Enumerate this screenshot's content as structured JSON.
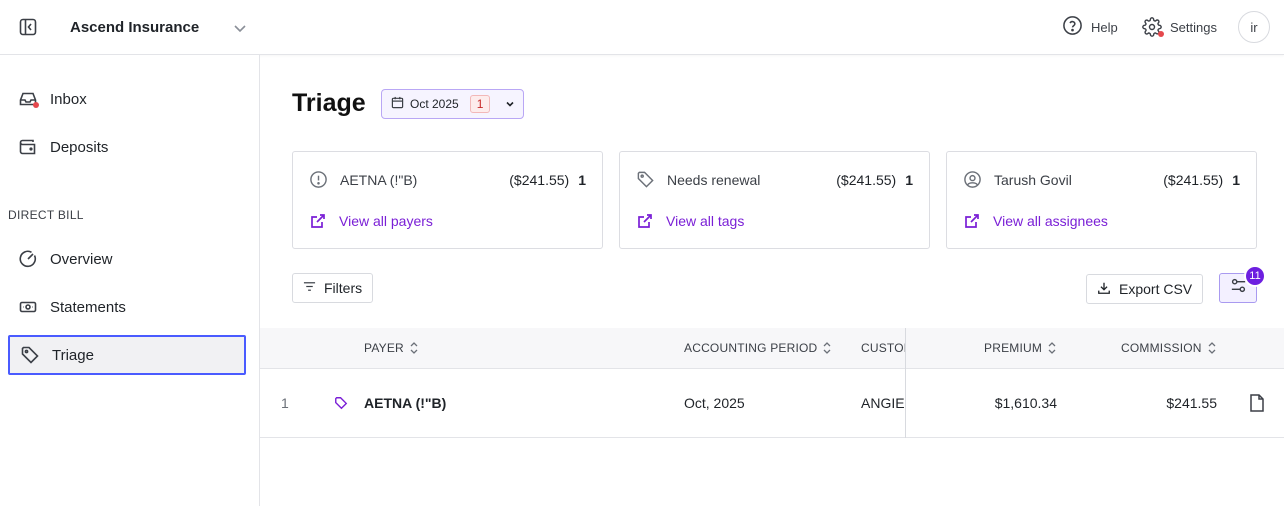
{
  "topbar": {
    "org_name": "Ascend Insurance",
    "help_label": "Help",
    "settings_label": "Settings",
    "avatar_initials": "ir"
  },
  "sidebar": {
    "items": [
      {
        "label": "Inbox",
        "icon": "inbox-icon"
      },
      {
        "label": "Deposits",
        "icon": "wallet-icon"
      }
    ],
    "section_label": "DIRECT BILL",
    "section_items": [
      {
        "label": "Overview",
        "icon": "gauge-icon"
      },
      {
        "label": "Statements",
        "icon": "banknote-icon"
      },
      {
        "label": "Triage",
        "icon": "tag-icon",
        "active": true
      }
    ]
  },
  "page": {
    "title": "Triage",
    "period_label": "Oct 2025",
    "period_badge": "1"
  },
  "cards": [
    {
      "label": "AETNA (!\"B)",
      "amount": "($241.55)",
      "count": "1",
      "link": "View all payers",
      "icon": "alert-circle-icon"
    },
    {
      "label": "Needs renewal",
      "amount": "($241.55)",
      "count": "1",
      "link": "View all tags",
      "icon": "tag-icon"
    },
    {
      "label": "Tarush Govil",
      "amount": "($241.55)",
      "count": "1",
      "link": "View all assignees",
      "icon": "user-circle-icon"
    }
  ],
  "toolbar": {
    "filters_label": "Filters",
    "export_label": "Export CSV",
    "columns_badge": "11"
  },
  "table": {
    "headers": {
      "payer": "PAYER",
      "accounting_period": "ACCOUNTING PERIOD",
      "customer": "CUSTOMER",
      "premium": "PREMIUM",
      "commission": "COMMISSION"
    },
    "rows": [
      {
        "index": "1",
        "payer": "AETNA (!\"B)",
        "accounting_period": "Oct, 2025",
        "customer": "ANGIE",
        "premium": "$1,610.34",
        "commission": "$241.55"
      }
    ]
  },
  "colors": {
    "accent": "#7a1fd6",
    "badge_purple": "#6d1fe0",
    "active_outline": "#4a5bff",
    "notification_red": "#e5484d"
  }
}
